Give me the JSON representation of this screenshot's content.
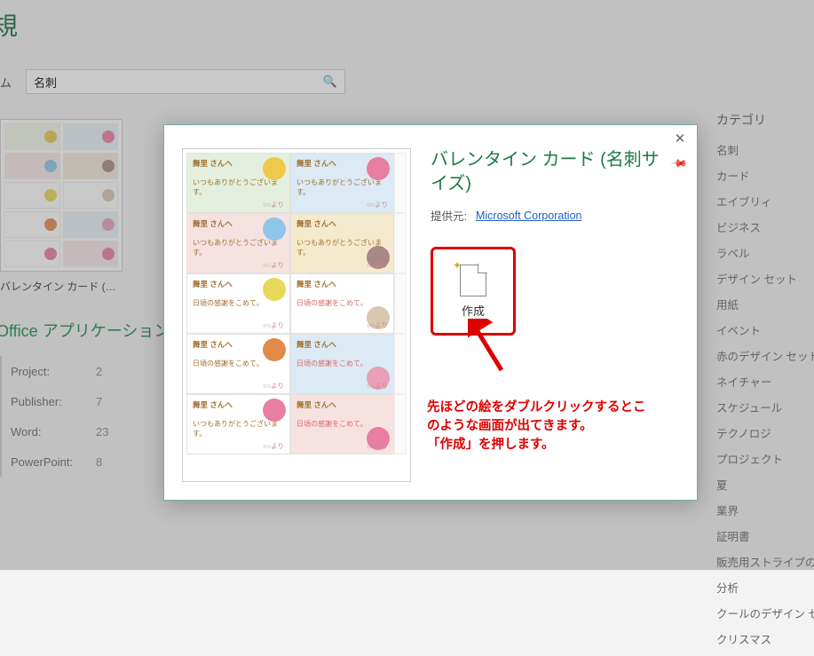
{
  "page": {
    "header_partial": "規",
    "nav_label_partial": "ム",
    "search": {
      "value": "名刺"
    }
  },
  "thumbnail": {
    "label": "バレンタイン カード (…"
  },
  "office_apps": {
    "heading": "Office アプリケーション",
    "items": [
      {
        "name": "Project:",
        "count": "2"
      },
      {
        "name": "Publisher:",
        "count": "7"
      },
      {
        "name": "Word:",
        "count": "23"
      },
      {
        "name": "PowerPoint:",
        "count": "8"
      }
    ]
  },
  "categories": {
    "heading": "カテゴリ",
    "items": [
      "名刺",
      "カード",
      "エイブリィ",
      "ビジネス",
      "ラベル",
      "デザイン セット",
      "用紙",
      "イベント",
      "赤のデザイン セット",
      "ネイチャー",
      "スケジュール",
      "テクノロジ",
      "プロジェクト",
      "夏",
      "業界",
      "証明書",
      "販売用ストライプの",
      "分析",
      "クールのデザイン セ",
      "クリスマス"
    ]
  },
  "modal": {
    "title": "バレンタイン カード (名刺サイズ)",
    "provided_by_label": "提供元:",
    "provided_by_link": "Microsoft Corporation",
    "create_label": "作成",
    "card": {
      "to": "舞里 さんへ",
      "msg1": "いつもありがとうございます。",
      "msg2": "日頃の感謝をこめて。",
      "from": "○○より"
    }
  },
  "annotation": {
    "line1": "先ほどの絵をダブルクリックするとこ",
    "line2": "のような画面が出てきます。",
    "line3": "「作成」を押します。"
  }
}
